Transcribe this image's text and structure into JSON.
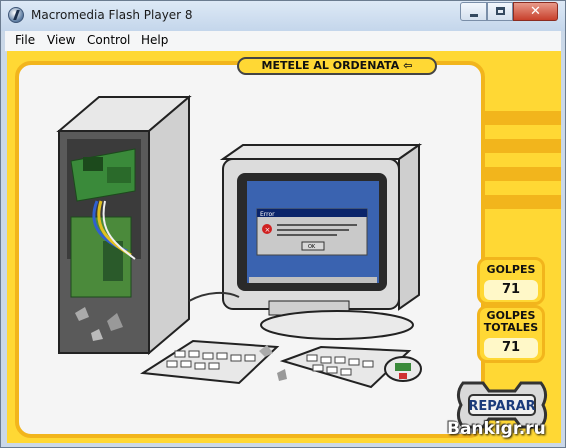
{
  "window": {
    "title": "Macromedia Flash Player 8",
    "close_glyph": "✕"
  },
  "menu": {
    "items": [
      "File",
      "View",
      "Control",
      "Help"
    ]
  },
  "game": {
    "headline": "METELE AL ORDENATA",
    "golpes_label": "GOLPES",
    "golpes_value": "71",
    "golpes_totales_label_line1": "GOLPES",
    "golpes_totales_label_line2": "TOTALES",
    "golpes_totales_value": "71",
    "repair_label": "REPARAR",
    "watermark": "Bankigr.ru",
    "error_dialog_title": "Error",
    "error_dialog_ok": "OK"
  },
  "colors": {
    "stage_yellow": "#ffd834",
    "frame_orange": "#f2b51c",
    "screen_blue": "#3a63b0"
  }
}
